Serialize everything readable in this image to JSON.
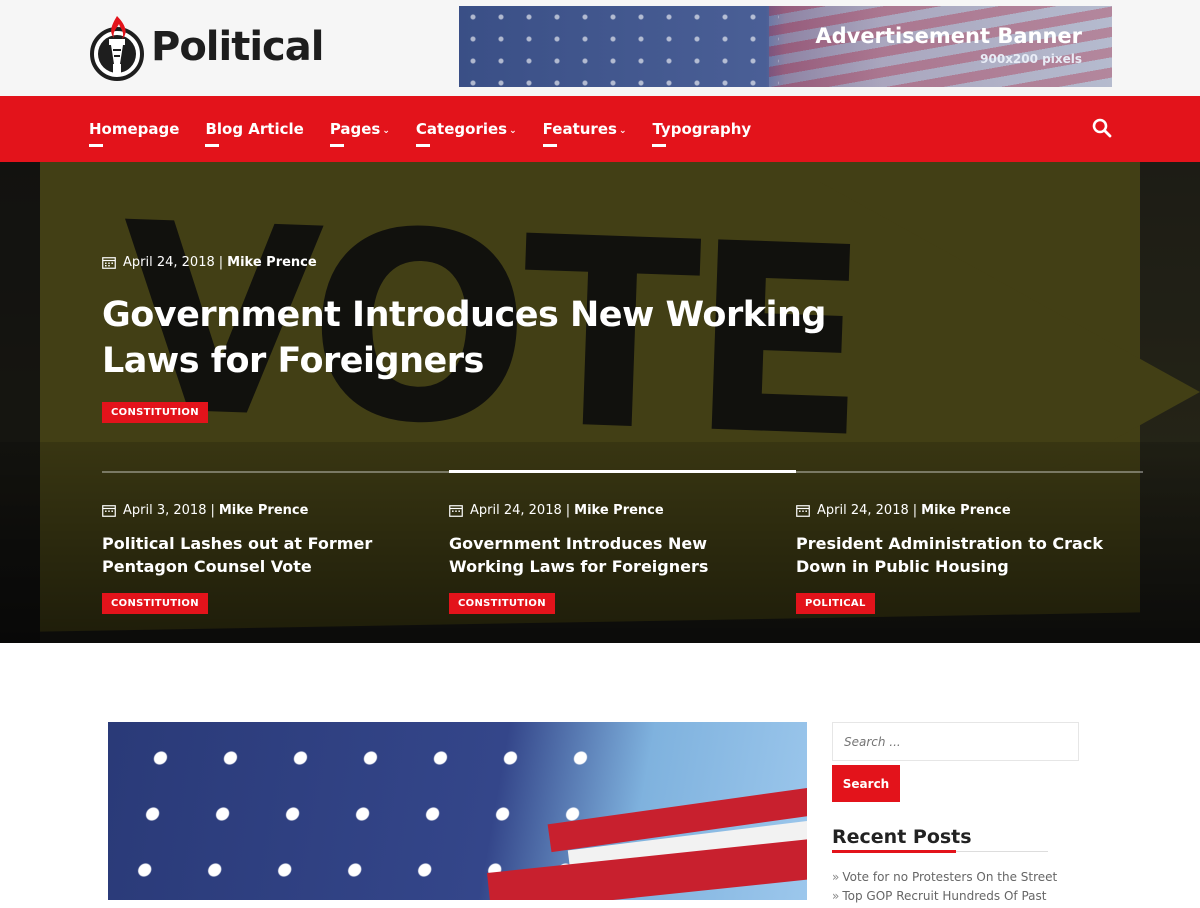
{
  "site": {
    "name": "Political"
  },
  "ad": {
    "title": "Advertisement Banner",
    "subtitle": "900x200 pixels"
  },
  "nav": {
    "items": [
      {
        "label": "Homepage",
        "dropdown": false
      },
      {
        "label": "Blog Article",
        "dropdown": false
      },
      {
        "label": "Pages",
        "dropdown": true
      },
      {
        "label": "Categories",
        "dropdown": true
      },
      {
        "label": "Features",
        "dropdown": true
      },
      {
        "label": "Typography",
        "dropdown": false
      }
    ],
    "search_icon": "search-icon",
    "chevron": "⌄"
  },
  "hero": {
    "date": "April 24, 2018",
    "separator": "|",
    "author": "Mike Prence",
    "title": "Government Introduces New Working Laws for Foreigners",
    "category": "CONSTITUTION",
    "background_word": "VOTE"
  },
  "slider": {
    "active_index": 1,
    "cards": [
      {
        "date": "April 3, 2018",
        "author": "Mike Prence",
        "title": "Political Lashes out at Former Pentagon Counsel Vote",
        "category": "CONSTITUTION"
      },
      {
        "date": "April 24, 2018",
        "author": "Mike Prence",
        "title": "Government Introduces New Working Laws for Foreigners",
        "category": "CONSTITUTION"
      },
      {
        "date": "April 24, 2018",
        "author": "Mike Prence",
        "title": "President Administration to Crack Down in Public Housing",
        "category": "POLITICAL"
      }
    ]
  },
  "sidebar": {
    "search_placeholder": "Search ...",
    "search_button": "Search",
    "recent_title": "Recent Posts",
    "recent_posts": [
      "Vote for no Protesters On the Street",
      "Top GOP Recruit Hundreds Of Past"
    ]
  },
  "colors": {
    "accent": "#e3131b",
    "header_bg": "#f6f6f6",
    "text_dark": "#1e1e1e"
  }
}
